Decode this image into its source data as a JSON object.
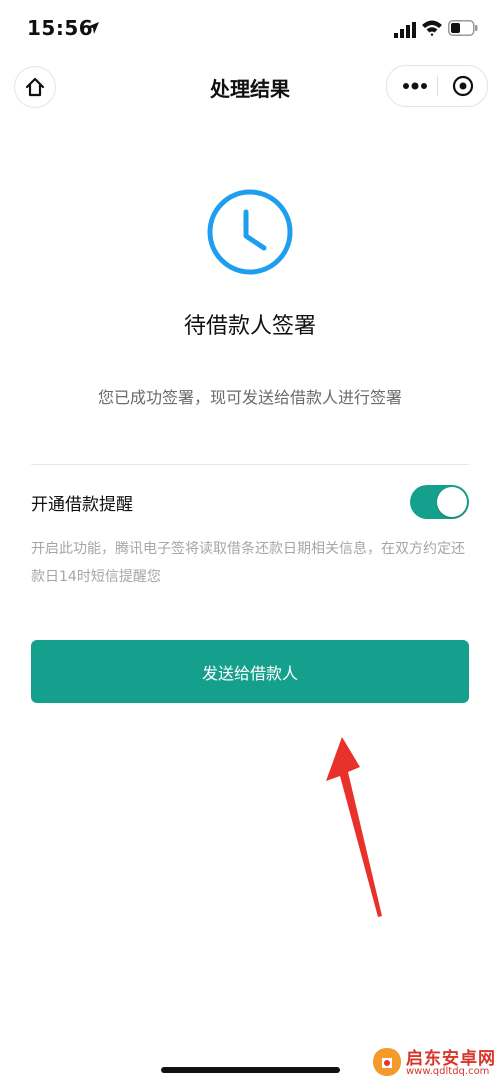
{
  "status_bar": {
    "time": "15:56",
    "location_icon": "location-arrow-icon",
    "signal_icon": "cellular-signal-icon",
    "wifi_icon": "wifi-icon",
    "battery_icon": "battery-icon"
  },
  "nav": {
    "title": "处理结果",
    "home_icon": "home-icon",
    "more_icon": "more-dots-icon",
    "close_icon": "target-close-icon"
  },
  "result": {
    "icon": "clock-icon",
    "heading": "待借款人签署",
    "description": "您已成功签署，现可发送给借款人进行签署"
  },
  "reminder": {
    "label": "开通借款提醒",
    "enabled": true,
    "description": "开启此功能，腾讯电子签将读取借条还款日期相关信息，在双方约定还款日14时短信提醒您"
  },
  "actions": {
    "send_label": "发送给借款人"
  },
  "watermark": {
    "name": "启东安卓网",
    "url": "www.qdltdq.com"
  },
  "colors": {
    "accent": "#15a08e",
    "clock_blue": "#1f9ef0",
    "arrow_red": "#e8312a",
    "watermark_red": "#d8362a"
  }
}
